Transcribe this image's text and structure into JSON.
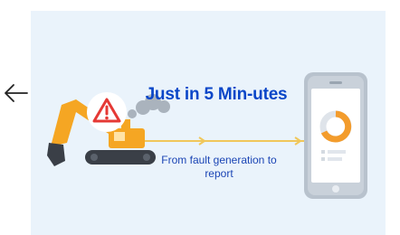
{
  "headline": "Just in 5 Min-utes",
  "subline": "From fault generation to report",
  "icons": {
    "back": "left-arrow-icon",
    "warning": "warning-triangle-icon",
    "machine": "excavator-icon",
    "device": "smartphone-icon",
    "chart": "donut-chart-icon"
  },
  "colors": {
    "panel_background": "#eaf3fb",
    "headline": "#0a46c8",
    "excavator": "#f5a623",
    "warning": "#e53935",
    "flow_line": "#f0c75a"
  }
}
